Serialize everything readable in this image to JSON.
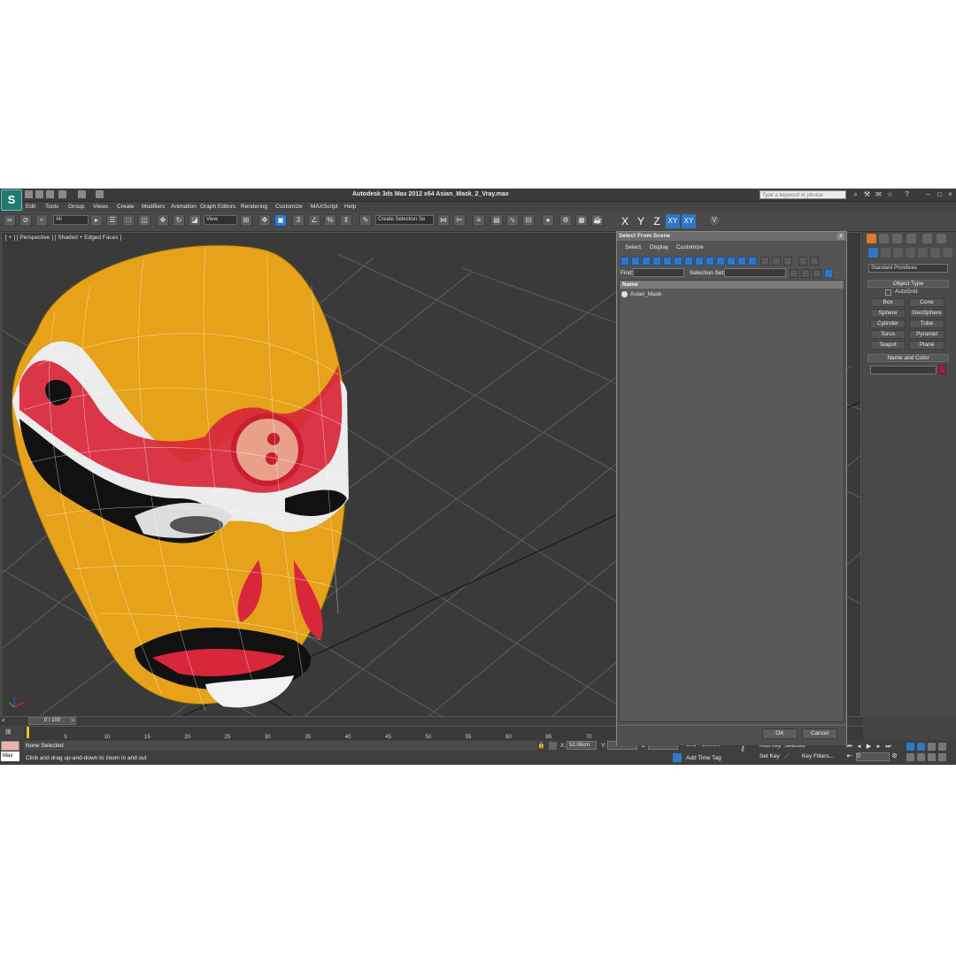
{
  "app": {
    "logo": "S",
    "title": "Autodesk 3ds Max  2012 x64     Asian_Mask_2_Vray.max",
    "search_placeholder": "Type a keyword or phrase"
  },
  "menu": [
    "Edit",
    "Tools",
    "Group",
    "Views",
    "Create",
    "Modifiers",
    "Animation",
    "Graph Editors",
    "Rendering",
    "Customize",
    "MAXScript",
    "Help"
  ],
  "toolbar": {
    "filter_all": "All",
    "ref_coord": "View",
    "selection_set": "Create Selection Se",
    "axes": [
      "X",
      "Y",
      "Z",
      "XY",
      "XY"
    ],
    "snap_3": "3",
    "snap_2_5": "2.5",
    "snap_pct": "%"
  },
  "viewport": {
    "label": "[ + ] [ Perspective ] [ Shaded + Edged Faces ]"
  },
  "dialog": {
    "title": "Select From Scene",
    "close": "x",
    "menus": [
      "Select",
      "Display",
      "Customize"
    ],
    "find_label": "Find:",
    "selset_label": "Selection Set:",
    "column_header": "Name",
    "items": [
      "Asian_Mask"
    ],
    "ok": "OK",
    "cancel": "Cancel"
  },
  "command_panel": {
    "category": "Standard Primitives",
    "object_type_title": "Object Type",
    "autogrid": "AutoGrid",
    "buttons": [
      "Box",
      "Cone",
      "Sphere",
      "GeoSphere",
      "Cylinder",
      "Tube",
      "Torus",
      "Pyramid",
      "Teapot",
      "Plane"
    ],
    "name_color_title": "Name and Color",
    "object_color": "#b01548"
  },
  "timeline": {
    "frame_label": "0 / 100",
    "ticks": [
      "5",
      "10",
      "15",
      "20",
      "25",
      "30",
      "35",
      "40",
      "45",
      "50",
      "55",
      "60",
      "65",
      "70"
    ],
    "current_frame": 0,
    "total_frames": 100
  },
  "status": {
    "maxscript_label": "Max",
    "selection": "None Selected",
    "prompt": "Click and drag up-and-down to zoom in and out",
    "x_label": "X:",
    "x_value": "52.06cm",
    "y_label": "Y:",
    "y_value": "",
    "z_label": "Z:",
    "z_value": "",
    "grid": "Grid = 10,0cm",
    "add_time_tag": "Add Time Tag",
    "auto_key": "Auto Key",
    "selected": "Selected",
    "set_key": "Set Key",
    "key_filters": "Key Filters...",
    "frame": "0"
  },
  "colors": {
    "accent": "#2f78c8",
    "viewport_bg": "#3a3a3a",
    "mask_yellow": "#e8a81c",
    "mask_red": "#d8263a"
  }
}
